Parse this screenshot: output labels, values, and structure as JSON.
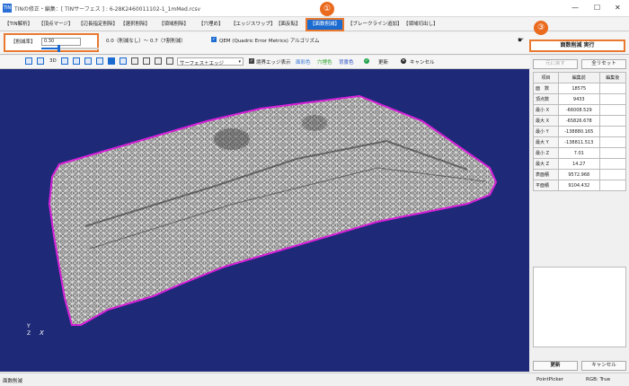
{
  "window": {
    "app_icon": "TIN",
    "title": "TINの修正・編集：[ TINサーフェス ] : 6-28K2460011102-1_1mMed.rcsv",
    "minimize": "—",
    "maximize": "☐",
    "close": "✕"
  },
  "tabs": [
    {
      "label": "【TIN解析】"
    },
    {
      "label": "【頂点マージ】"
    },
    {
      "label": "【辺長指定削除】"
    },
    {
      "label": "【選択削除】"
    },
    {
      "label": "【領域削除】"
    },
    {
      "label": "【穴埋め】"
    },
    {
      "label": "【エッジスワップ】"
    },
    {
      "label": "【面反転】"
    },
    {
      "label": "【面数削減】"
    },
    {
      "label": "【ブレークライン追加】"
    },
    {
      "label": "【領域切出し】"
    }
  ],
  "options": {
    "ratio_label": "【削減率】",
    "ratio_value": "0.30",
    "slider_level": 0.3,
    "range_text": "0.0（削減なし）～ 0.7（7割削減）",
    "qem_check": "✓",
    "qem_label": "QEM (Quadric Error Metrics) アルゴリズム",
    "hand_icon": "☛",
    "execute_label": "面数削減 実行"
  },
  "badges": {
    "one": "①",
    "two": "②",
    "three": "③"
  },
  "toolbar": {
    "label_3d": "3D",
    "surface_mode": "サーフェス＋エッジ",
    "dropdown_arrow": "▾",
    "boundary_check": "✓",
    "boundary_label": "境界エッジ表示",
    "face_color": "面彩色",
    "hole_color": "穴埋色",
    "bg_color": "背景色",
    "update_label": "更新",
    "cancel_label": "キャンセル"
  },
  "colors": {
    "face": "#2a6fd6",
    "hole": "#20a020",
    "bg": "#1c3fbf",
    "viewport": "#1e2a78",
    "boundary": "#e020e0",
    "accent": "#e8792f"
  },
  "side": {
    "undo_label": "元に戻す",
    "reset_label": "全リセット",
    "headers": [
      "項目",
      "編集前",
      "編集後"
    ],
    "rows": [
      {
        "item": "面　数",
        "before": "18575",
        "after": ""
      },
      {
        "item": "頂点数",
        "before": "9433",
        "after": ""
      },
      {
        "item": "最小 X",
        "before": "-66008.529",
        "after": ""
      },
      {
        "item": "最大 X",
        "before": "-65826.678",
        "after": ""
      },
      {
        "item": "最小 Y",
        "before": "-138880.165",
        "after": ""
      },
      {
        "item": "最大 Y",
        "before": "-138811.513",
        "after": ""
      },
      {
        "item": "最小 Z",
        "before": "7.01",
        "after": ""
      },
      {
        "item": "最大 Z",
        "before": "14.27",
        "after": ""
      },
      {
        "item": "表面積",
        "before": "9572.968",
        "after": ""
      },
      {
        "item": "平面積",
        "before": "9104.432",
        "after": ""
      }
    ],
    "update_label": "更新",
    "cancel_label": "キャンセル"
  },
  "axes": {
    "y": "Y",
    "z": "Z",
    "x": "X"
  },
  "status": {
    "left": "面数削減",
    "picker": "PointPicker",
    "rgb": "RGB: True"
  }
}
